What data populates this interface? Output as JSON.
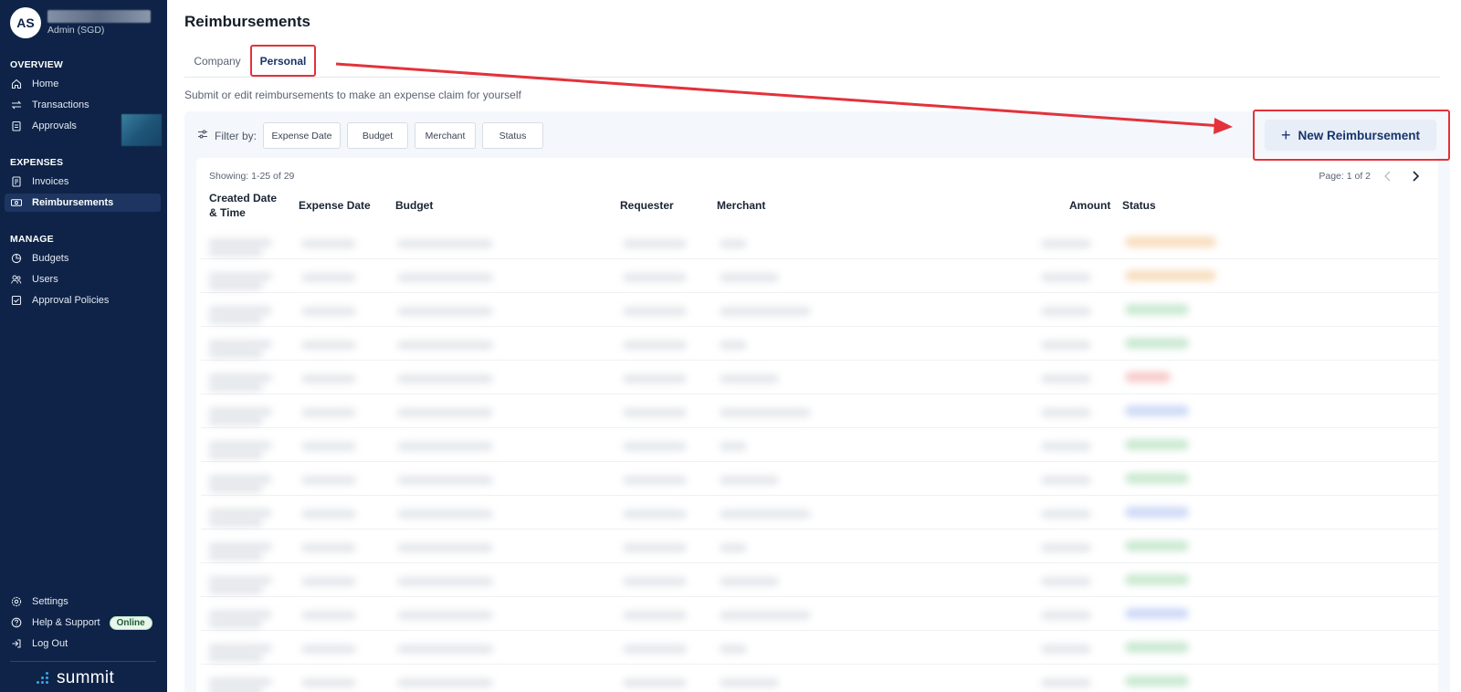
{
  "user": {
    "initials": "AS",
    "role": "Admin (SGD)"
  },
  "sidebar": {
    "sections": [
      {
        "title": "OVERVIEW"
      },
      {
        "title": "EXPENSES"
      },
      {
        "title": "MANAGE"
      }
    ],
    "items": [
      {
        "label": "Home",
        "icon": "home-icon"
      },
      {
        "label": "Transactions",
        "icon": "transfer-icon"
      },
      {
        "label": "Approvals",
        "icon": "clipboard-icon"
      },
      {
        "label": "Invoices",
        "icon": "invoice-icon"
      },
      {
        "label": "Reimbursements",
        "icon": "cash-icon",
        "active": true
      },
      {
        "label": "Budgets",
        "icon": "pie-chart-icon"
      },
      {
        "label": "Users",
        "icon": "users-icon"
      },
      {
        "label": "Approval Policies",
        "icon": "policy-icon"
      }
    ],
    "bottom_items": [
      {
        "label": "Settings",
        "icon": "gear-icon"
      },
      {
        "label": "Help & Support",
        "icon": "help-icon",
        "badge": "Online"
      },
      {
        "label": "Log Out",
        "icon": "logout-icon"
      }
    ],
    "brand": "summit"
  },
  "page": {
    "title": "Reimbursements",
    "tabs": [
      {
        "label": "Company"
      },
      {
        "label": "Personal",
        "active": true
      }
    ],
    "subtitle": "Submit or edit reimbursements to make an expense claim for yourself",
    "filter_label": "Filter by:",
    "filters": [
      "Expense Date",
      "Budget",
      "Merchant",
      "Status"
    ],
    "new_button_label": "New Reimbursement"
  },
  "table": {
    "showing": "Showing: 1-25 of 29",
    "page": "Page: 1 of 2",
    "columns": [
      {
        "label": "Created Date & Time"
      },
      {
        "label": "Expense Date"
      },
      {
        "label": "Budget"
      },
      {
        "label": "Requester"
      },
      {
        "label": "Merchant"
      },
      {
        "label": "Amount"
      },
      {
        "label": "Status"
      }
    ],
    "row_count": 14,
    "status_colors": [
      "#f2c48c",
      "#f2c48c",
      "#9fd8ad",
      "#9fd8ad",
      "#f0a3a3",
      "#a9bdf0",
      "#9fd8ad",
      "#9fd8ad",
      "#a9bdf0",
      "#9fd8ad",
      "#9fd8ad",
      "#a9bdf0",
      "#9fd8ad",
      "#9fd8ad"
    ]
  },
  "colors": {
    "sidebar_bg": "#0e2347",
    "accent": "#17356b",
    "annotation_red": "#e3323b"
  }
}
